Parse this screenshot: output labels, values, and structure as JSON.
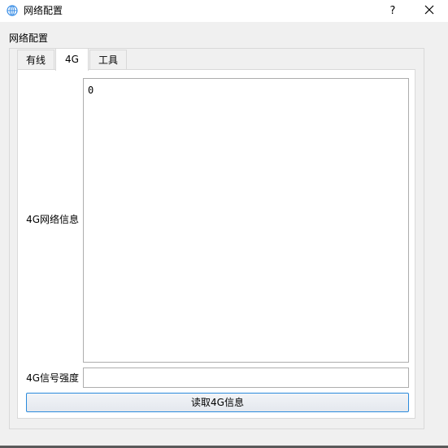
{
  "window": {
    "title": "网络配置",
    "help_label": "?",
    "icon": "network-globe-icon",
    "close_icon": "close-icon"
  },
  "group": {
    "title": "网络配置"
  },
  "tabs": [
    {
      "label": "有线",
      "active": false
    },
    {
      "label": "4G",
      "active": true
    },
    {
      "label": "工具",
      "active": false
    }
  ],
  "panel_4g": {
    "info_label": "4G网络信息",
    "info_value": "0",
    "signal_label": "4G信号强度",
    "signal_value": "",
    "read_button_label": "读取4G信息"
  },
  "colors": {
    "accent": "#2a8adc",
    "icon_blue": "#3a8ee6",
    "background": "#f0f0f0",
    "panel": "#ffffff",
    "border": "#d9d9d9"
  }
}
